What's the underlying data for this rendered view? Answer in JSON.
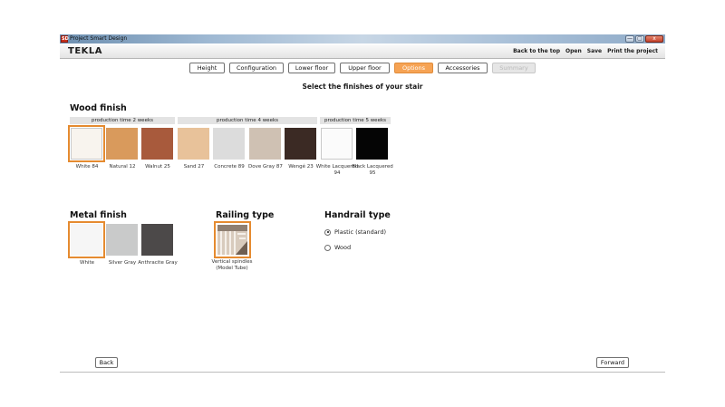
{
  "window": {
    "title": "Project Smart Design",
    "icon_text": "SD",
    "buttons": [
      "—",
      "▢",
      "x"
    ]
  },
  "header": {
    "logo": "TEKLA",
    "links": [
      "Back to the top",
      "Open",
      "Save",
      "Print the project"
    ]
  },
  "steps": [
    {
      "label": "Height",
      "state": "normal"
    },
    {
      "label": "Configuration",
      "state": "normal"
    },
    {
      "label": "Lower floor",
      "state": "normal"
    },
    {
      "label": "Upper floor",
      "state": "normal"
    },
    {
      "label": "Options",
      "state": "active"
    },
    {
      "label": "Accessories",
      "state": "normal"
    },
    {
      "label": "Summary",
      "state": "disabled"
    }
  ],
  "subtitle": "Select the finishes of your stair",
  "wood": {
    "title": "Wood finish",
    "production_groups": [
      "production time 2 weeks",
      "production time 4 weeks",
      "production time 5 weeks"
    ],
    "swatches": [
      {
        "label": "White 84",
        "color": "#f8f4ee",
        "selected": true
      },
      {
        "label": "Natural 12",
        "color": "#d99a5c",
        "selected": false
      },
      {
        "label": "Walnut 25",
        "color": "#a85a3c",
        "selected": false
      },
      {
        "label": "Sand 27",
        "color": "#e8c29a",
        "selected": false
      },
      {
        "label": "Concrete 89",
        "color": "#dcdcdc",
        "selected": false
      },
      {
        "label": "Dove Gray 87",
        "color": "#cfc1b3",
        "selected": false
      },
      {
        "label": "Wengé 23",
        "color": "#3b2a24",
        "selected": false
      },
      {
        "label": "White Lacquered 94",
        "color": "#fbfbfb",
        "selected": false
      },
      {
        "label": "Black Lacquered 95",
        "color": "#050505",
        "selected": false
      }
    ]
  },
  "metal": {
    "title": "Metal finish",
    "swatches": [
      {
        "label": "White",
        "color": "#f6f6f6",
        "selected": true
      },
      {
        "label": "Silver Gray",
        "color": "#c9caca",
        "selected": false
      },
      {
        "label": "Anthracite Gray",
        "color": "#4c4949",
        "selected": false
      }
    ]
  },
  "railing": {
    "title": "Railing type",
    "option": {
      "label": "Vertical spindles (Model Tube)",
      "selected": true
    }
  },
  "handrail": {
    "title": "Handrail type",
    "options": [
      {
        "label": "Plastic (standard)",
        "checked": true
      },
      {
        "label": "Wood",
        "checked": false
      }
    ]
  },
  "nav": {
    "back": "Back",
    "forward": "Forward"
  },
  "colors": {
    "accent": "#f6a354",
    "selection_outline": "#e58b30"
  }
}
